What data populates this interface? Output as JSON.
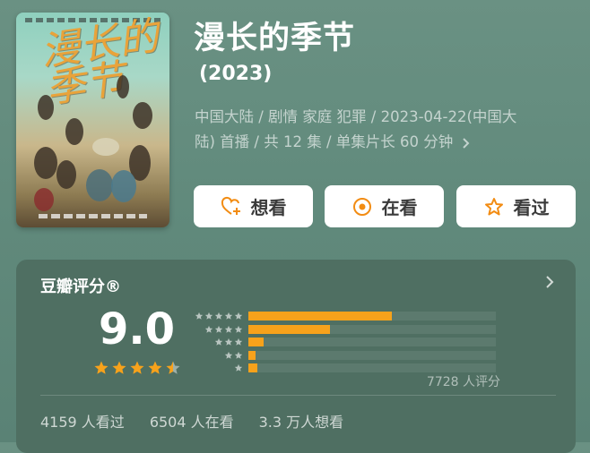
{
  "poster": {
    "alt_title": "漫长的季节",
    "colors": {
      "title_gold": "#e9a33a"
    }
  },
  "header": {
    "title": "漫长的季节",
    "year": "(2023)",
    "meta_line1": "中国大陆 / 剧情 家庭 犯罪 / 2023-04-22(中国大",
    "meta_line2": "陆) 首播 / 共 12 集 / 单集片长 60 分钟",
    "meta_more_icon": "chevron-right-icon"
  },
  "actions": [
    {
      "label": "想看",
      "icon": "heart-plus-icon"
    },
    {
      "label": "在看",
      "icon": "target-circle-icon"
    },
    {
      "label": "看过",
      "icon": "star-outline-icon"
    }
  ],
  "rating": {
    "heading": "豆瓣评分®",
    "score": "9.0",
    "stars": 4.5,
    "distribution": [
      {
        "stars": 5,
        "fraction": 0.58
      },
      {
        "stars": 4,
        "fraction": 0.33
      },
      {
        "stars": 3,
        "fraction": 0.06
      },
      {
        "stars": 2,
        "fraction": 0.03
      },
      {
        "stars": 1,
        "fraction": 0.035
      }
    ],
    "count_label": "7728 人评分",
    "stats": [
      "4159 人看过",
      "6504 人在看",
      "3.3 万人想看"
    ]
  },
  "colors": {
    "accent": "#f7a21b",
    "orange_icon": "#f28c13",
    "card_bg": "#4f6f62"
  }
}
